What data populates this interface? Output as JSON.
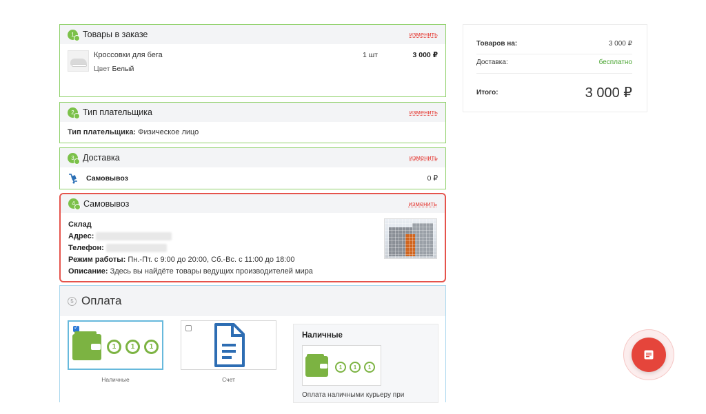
{
  "colors": {
    "accent_green": "#7cc14a",
    "accent_red": "#e5433d",
    "price_green": "#47a32e",
    "fab_red": "#e5453b"
  },
  "order_items": {
    "step": "1",
    "title": "Товары в заказе",
    "change_label": "изменить",
    "product": {
      "name": "Кроссовки для бега",
      "color_label": "Цвет",
      "color_value": "Белый",
      "quantity": "1 шт",
      "price": "3 000 ₽"
    }
  },
  "payer_type": {
    "step": "2",
    "title": "Тип плательщика",
    "change_label": "изменить",
    "line_label": "Тип плательщика:",
    "line_value": "Физическое лицо"
  },
  "delivery": {
    "step": "3",
    "title": "Доставка",
    "change_label": "изменить",
    "icon": "delivery-cart-icon",
    "method": "Самовывоз",
    "price": "0 ₽"
  },
  "pickup": {
    "step": "4",
    "title": "Самовывоз",
    "change_label": "изменить",
    "warehouse_label": "Склад",
    "address_label": "Адрес:",
    "phone_label": "Телефон:",
    "hours_label": "Режим работы:",
    "hours_value": "Пн.-Пт. с 9:00 до 20:00, Сб.-Вс. с 11:00 до 18:00",
    "description_label": "Описание:",
    "description_value": "Здесь вы найдёте товары ведущих производителей мира"
  },
  "payment": {
    "step": "5",
    "title": "Оплата",
    "options": [
      {
        "label": "Наличные",
        "selected": true,
        "icon": "wallet-icon"
      },
      {
        "label": "Счет",
        "selected": false,
        "icon": "invoice-document-icon"
      }
    ],
    "detail_title": "Наличные",
    "detail_description": "Оплата наличными курьеру при"
  },
  "summary": {
    "goods_label": "Товаров на:",
    "goods_value": "3 000 ₽",
    "delivery_label": "Доставка:",
    "delivery_value": "бесплатно",
    "total_label": "Итого:",
    "total_value": "3 000 ₽"
  },
  "fab": {
    "icon": "order-document-icon"
  }
}
